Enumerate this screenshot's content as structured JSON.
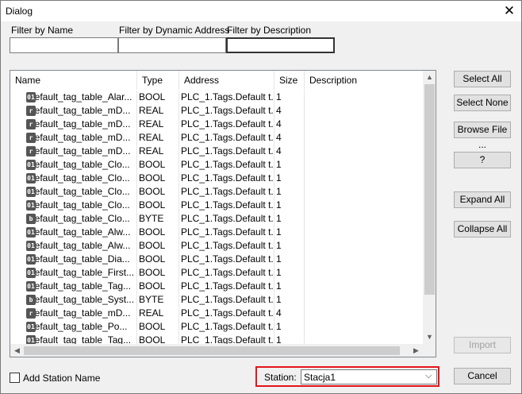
{
  "window": {
    "title": "Dialog"
  },
  "filters": {
    "name_label": "Filter by Name",
    "address_label": "Filter by Dynamic Address",
    "description_label": "Filter by Description",
    "name_value": "",
    "address_value": "",
    "description_value": ""
  },
  "table": {
    "columns": [
      "Name",
      "Type",
      "Address",
      "Size",
      "Description"
    ],
    "rows": [
      {
        "icon": "01",
        "name": "Default_tag_table_Alar...",
        "type": "BOOL",
        "address": "PLC_1.Tags.Default t...",
        "size": "1"
      },
      {
        "icon": "r",
        "name": "Default_tag_table_mD...",
        "type": "REAL",
        "address": "PLC_1.Tags.Default t...",
        "size": "4"
      },
      {
        "icon": "r",
        "name": "Default_tag_table_mD...",
        "type": "REAL",
        "address": "PLC_1.Tags.Default t...",
        "size": "4"
      },
      {
        "icon": "r",
        "name": "Default_tag_table_mD...",
        "type": "REAL",
        "address": "PLC_1.Tags.Default t...",
        "size": "4"
      },
      {
        "icon": "r",
        "name": "Default_tag_table_mD...",
        "type": "REAL",
        "address": "PLC_1.Tags.Default t...",
        "size": "4"
      },
      {
        "icon": "01",
        "name": "Default_tag_table_Clo...",
        "type": "BOOL",
        "address": "PLC_1.Tags.Default t...",
        "size": "1"
      },
      {
        "icon": "01",
        "name": "Default_tag_table_Clo...",
        "type": "BOOL",
        "address": "PLC_1.Tags.Default t...",
        "size": "1"
      },
      {
        "icon": "01",
        "name": "Default_tag_table_Clo...",
        "type": "BOOL",
        "address": "PLC_1.Tags.Default t...",
        "size": "1"
      },
      {
        "icon": "01",
        "name": "Default_tag_table_Clo...",
        "type": "BOOL",
        "address": "PLC_1.Tags.Default t...",
        "size": "1"
      },
      {
        "icon": "b",
        "name": "Default_tag_table_Clo...",
        "type": "BYTE",
        "address": "PLC_1.Tags.Default t...",
        "size": "1"
      },
      {
        "icon": "01",
        "name": "Default_tag_table_Alw...",
        "type": "BOOL",
        "address": "PLC_1.Tags.Default t...",
        "size": "1"
      },
      {
        "icon": "01",
        "name": "Default_tag_table_Alw...",
        "type": "BOOL",
        "address": "PLC_1.Tags.Default t...",
        "size": "1"
      },
      {
        "icon": "01",
        "name": "Default_tag_table_Dia...",
        "type": "BOOL",
        "address": "PLC_1.Tags.Default t...",
        "size": "1"
      },
      {
        "icon": "01",
        "name": "Default_tag_table_First...",
        "type": "BOOL",
        "address": "PLC_1.Tags.Default t...",
        "size": "1"
      },
      {
        "icon": "01",
        "name": "Default_tag_table_Tag...",
        "type": "BOOL",
        "address": "PLC_1.Tags.Default t...",
        "size": "1"
      },
      {
        "icon": "b",
        "name": "Default_tag_table_Syst...",
        "type": "BYTE",
        "address": "PLC_1.Tags.Default t...",
        "size": "1"
      },
      {
        "icon": "r",
        "name": "Default_tag_table_mD...",
        "type": "REAL",
        "address": "PLC_1.Tags.Default t...",
        "size": "4"
      },
      {
        "icon": "01",
        "name": "Default_tag_table_Po...",
        "type": "BOOL",
        "address": "PLC_1.Tags.Default t...",
        "size": "1"
      },
      {
        "icon": "01",
        "name": "Default_tag_table_Tag...",
        "type": "BOOL",
        "address": "PLC_1.Tags.Default t...",
        "size": "1"
      }
    ]
  },
  "buttons": {
    "select_all": "Select All",
    "select_none": "Select None",
    "browse_file": "Browse File ...",
    "help": "?",
    "expand_all": "Expand All",
    "collapse_all": "Collapse All",
    "import": "Import",
    "cancel": "Cancel"
  },
  "footer": {
    "add_station_label": "Add Station Name",
    "station_label": "Station:",
    "station_value": "Stacja1"
  },
  "colors": {
    "highlight_border": "#e4141b"
  }
}
